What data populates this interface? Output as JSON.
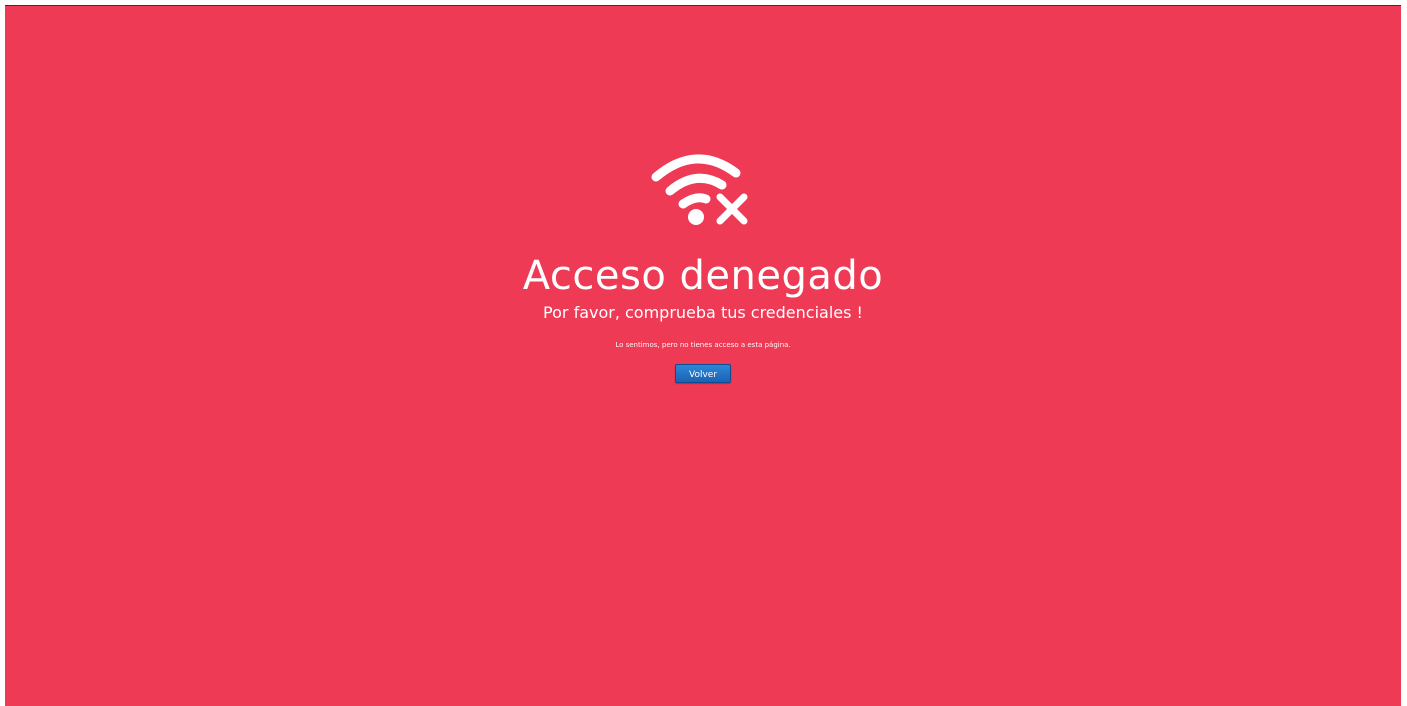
{
  "page": {
    "background_color": "#ee3a55",
    "text_color": "#ffffff",
    "button_color": "#1e6fc4"
  },
  "icon": {
    "name": "wifi-off-icon"
  },
  "error": {
    "title": "Acceso denegado",
    "subtitle": "Por favor, comprueba tus credenciales !",
    "message": "Lo sentimos, pero no tienes acceso a esta página."
  },
  "actions": {
    "back_label": "Volver"
  }
}
